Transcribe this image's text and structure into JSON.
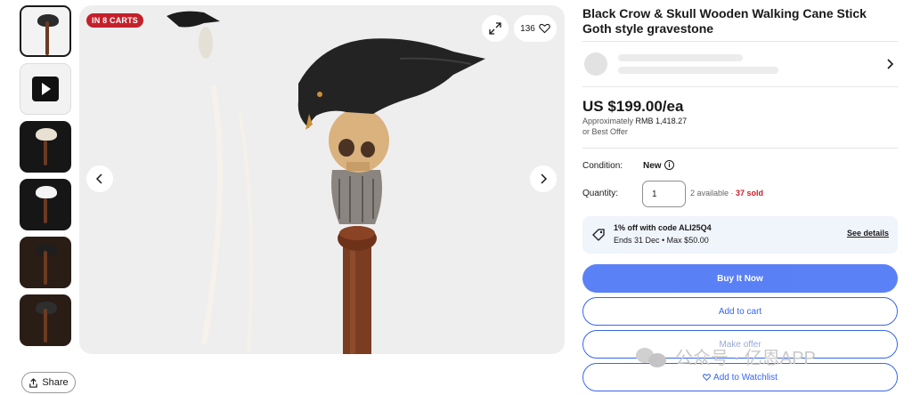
{
  "thumbnails": [
    {
      "kind": "image",
      "selected": true
    },
    {
      "kind": "video"
    },
    {
      "kind": "image"
    },
    {
      "kind": "image"
    },
    {
      "kind": "image"
    },
    {
      "kind": "image"
    }
  ],
  "share": {
    "label": "Share",
    "icon": "share-icon"
  },
  "gallery": {
    "badge": "IN 8 CARTS",
    "watch_count": "136",
    "expand_icon": "expand-icon",
    "heart_icon": "heart-icon",
    "prev_icon": "chevron-left-icon",
    "next_icon": "chevron-right-icon"
  },
  "listing": {
    "title": "Black Crow & Skull Wooden Walking Cane Stick Goth style gravestone",
    "price": "US $199.00/ea",
    "approx_prefix": "Approximately",
    "approx_value": "RMB 1,418.27",
    "best_offer": "or Best Offer",
    "condition_label": "Condition:",
    "condition_value": "New",
    "quantity_label": "Quantity:",
    "quantity_value": "1",
    "available": "2 available",
    "sold": "37 sold"
  },
  "promo": {
    "line1": "1% off with code ALI25Q4",
    "line2": "Ends 31 Dec • Max $50.00",
    "link": "See details"
  },
  "actions": {
    "buy": "Buy It Now",
    "cart": "Add to cart",
    "offer": "Make offer",
    "watch": "Add to Watchlist"
  },
  "watermark": {
    "text": "公众号 · 亿恩APP"
  },
  "colors": {
    "accent": "#3665f3",
    "badge": "#c4202b",
    "sold": "#c4202b",
    "promo_bg": "#f0f4fb"
  }
}
